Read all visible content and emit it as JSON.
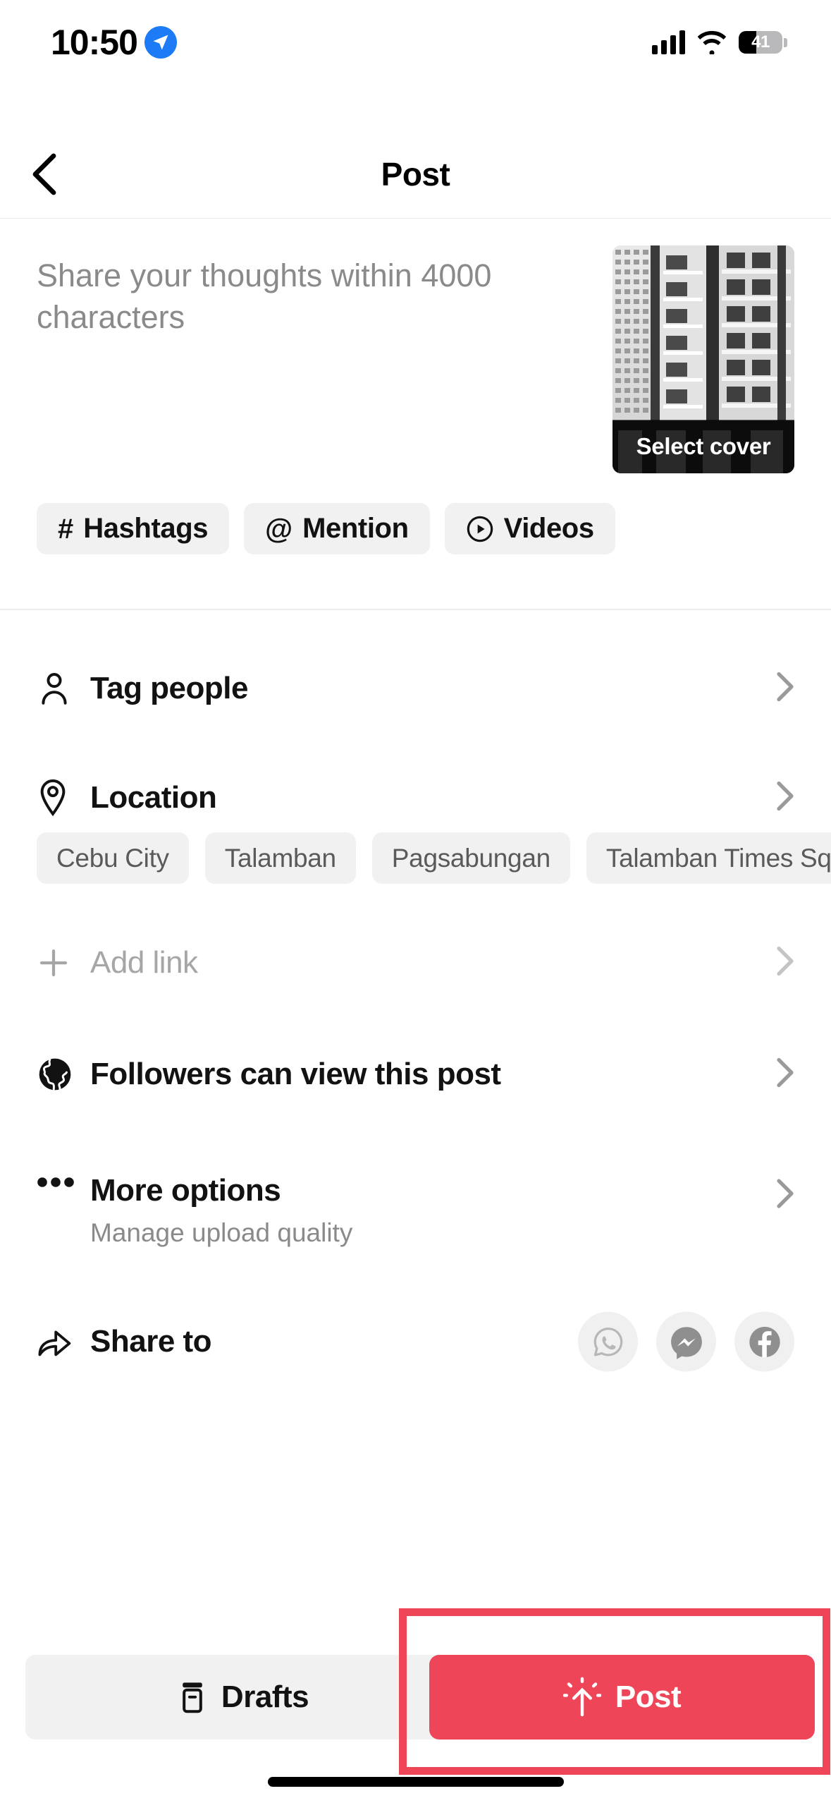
{
  "status_bar": {
    "time": "10:50",
    "location_icon": "location-arrow-icon",
    "signal_icon": "cellular-signal-icon",
    "wifi_icon": "wifi-icon",
    "battery_level": "41",
    "battery_percent": 41
  },
  "header": {
    "back_icon": "chevron-left-icon",
    "title": "Post"
  },
  "caption": {
    "placeholder": "Share your thoughts within 4000 characters",
    "value": "",
    "max_characters": 4000
  },
  "cover": {
    "label": "Select cover",
    "alt": "grayscale photo of apartment building facade"
  },
  "caption_chips": [
    {
      "glyph": "#",
      "label": "Hashtags",
      "icon": "hashtag-icon"
    },
    {
      "glyph": "@",
      "label": "Mention",
      "icon": "at-mention-icon"
    },
    {
      "glyph": "⊙",
      "label": "Videos",
      "icon": "play-circle-icon"
    }
  ],
  "rows": {
    "tag_people": {
      "label": "Tag people",
      "icon": "person-icon"
    },
    "location": {
      "label": "Location",
      "icon": "location-pin-icon"
    },
    "add_link": {
      "label": "Add link",
      "icon": "plus-icon"
    },
    "privacy": {
      "label": "Followers can view this post",
      "icon": "globe-icon"
    },
    "more_options": {
      "label": "More options",
      "subtitle": "Manage upload quality",
      "icon": "ellipsis-icon"
    },
    "share_to": {
      "label": "Share to",
      "icon": "share-arrow-icon"
    }
  },
  "location_suggestions": [
    "Cebu City",
    "Talamban",
    "Pagsabungan",
    "Talamban Times Sq"
  ],
  "share_targets": [
    {
      "name": "whatsapp-icon",
      "label": "WhatsApp"
    },
    {
      "name": "messenger-icon",
      "label": "Messenger"
    },
    {
      "name": "facebook-icon",
      "label": "Facebook"
    }
  ],
  "bottom_bar": {
    "drafts_label": "Drafts",
    "drafts_icon": "drafts-archive-icon",
    "post_label": "Post",
    "post_icon": "post-upload-sparkle-icon"
  },
  "colors": {
    "accent_red": "#ee4558",
    "chip_bg": "#f1f1f1",
    "muted_text": "#8a8a8a",
    "primary_text": "#121212",
    "divider": "#ededed",
    "status_blue": "#1d7bf5"
  }
}
